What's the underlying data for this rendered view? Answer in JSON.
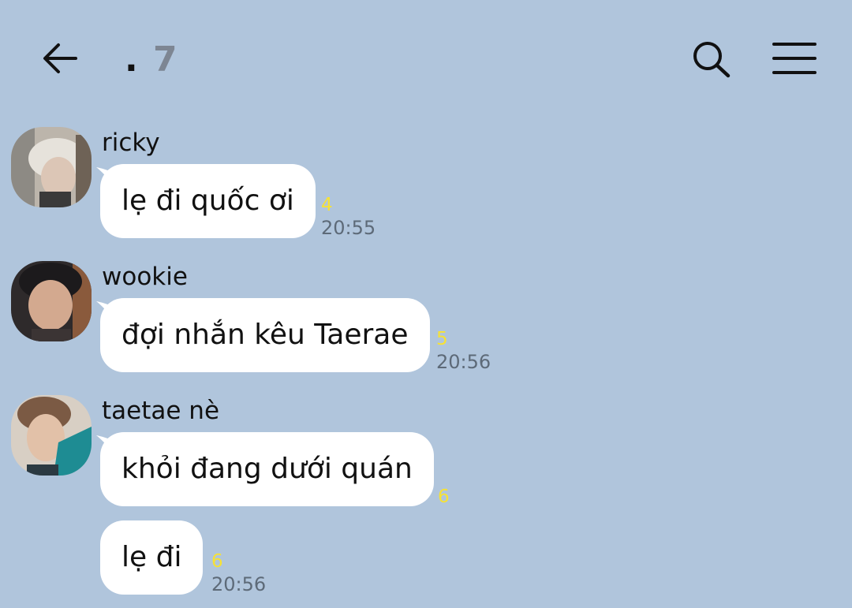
{
  "header": {
    "title_dot": ".",
    "title_count": "7",
    "back_icon": "arrow-left-icon",
    "search_icon": "search-icon",
    "menu_icon": "hamburger-menu-icon"
  },
  "colors": {
    "background": "#b0c5dc",
    "bubble": "#ffffff",
    "unread": "#f7e234",
    "time": "#5d6a78"
  },
  "messages": [
    {
      "sender": "ricky",
      "text": "lẹ đi quốc ơi",
      "unread": "4",
      "time": "20:55"
    },
    {
      "sender": "wookie",
      "text": "đợi nhắn kêu Taerae",
      "unread": "5",
      "time": "20:56"
    },
    {
      "sender": "taetae nè",
      "text": "khỏi đang dưới quán",
      "unread": "6",
      "time": ""
    },
    {
      "sender": "",
      "text": "lẹ đi",
      "unread": "6",
      "time": "20:56"
    }
  ]
}
